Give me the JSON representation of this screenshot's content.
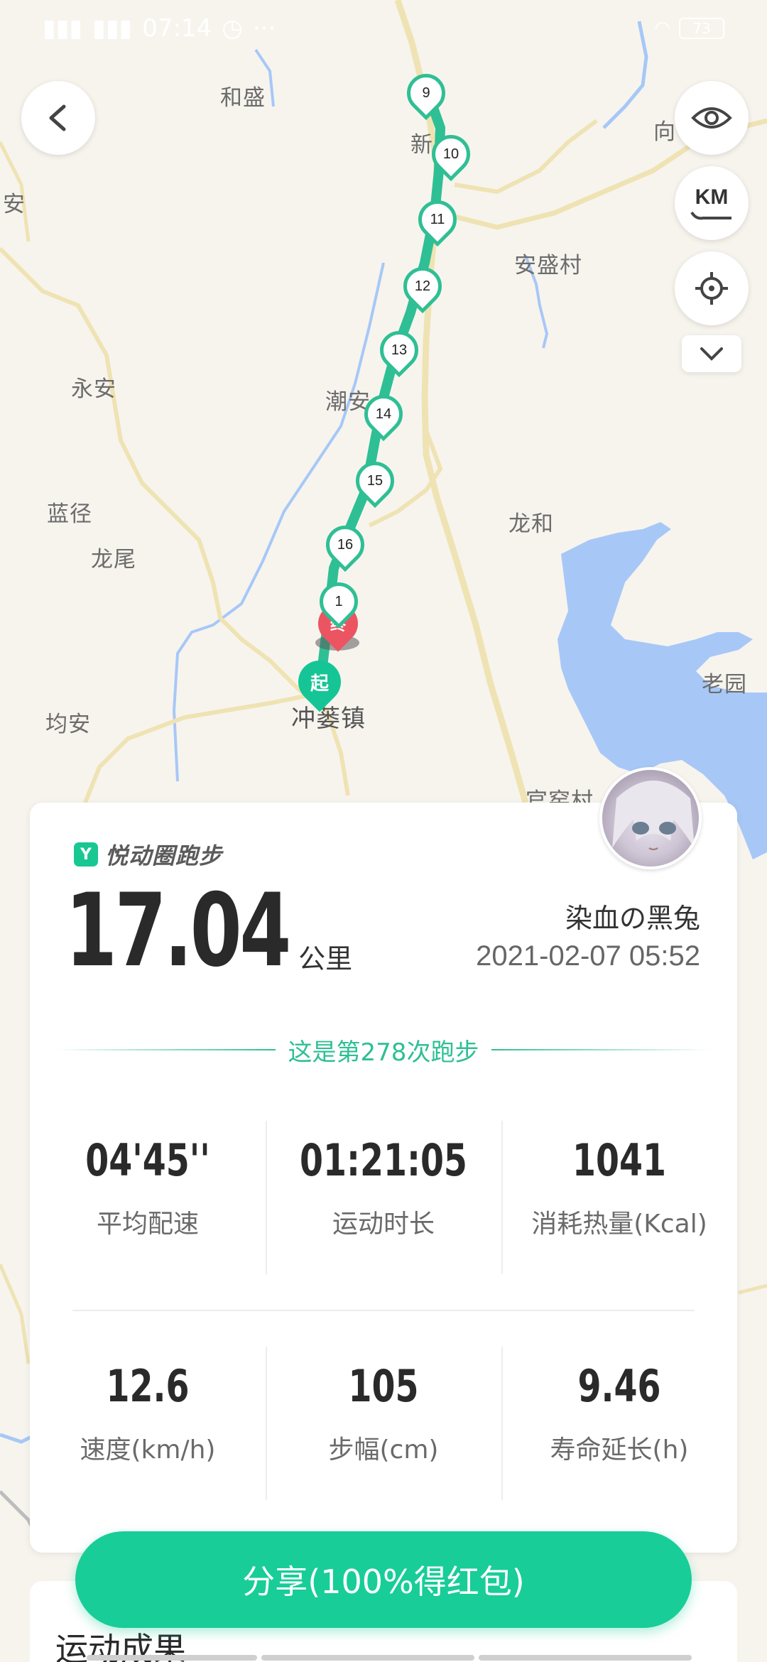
{
  "status_bar": {
    "time": "07:14",
    "battery": "73"
  },
  "map": {
    "places": [
      "和盛",
      "安",
      "永安",
      "蓝径",
      "龙尾",
      "均安",
      "冲蒌镇",
      "潮安",
      "龙和",
      "安盛村",
      "向",
      "老园",
      "官窑村",
      "新"
    ],
    "route_markers": [
      "9",
      "10",
      "11",
      "12",
      "13",
      "14",
      "15",
      "16",
      "1"
    ],
    "start_label": "起",
    "end_label": "终",
    "route_color": "#2fbf94",
    "water_color": "#a7c8f7"
  },
  "controls": {
    "km_label": "KM"
  },
  "card": {
    "brand": "悦动圈跑步",
    "distance": "17.04",
    "distance_unit": "公里",
    "user_name": "染血の黑兔",
    "date": "2021-02-07 05:52",
    "run_count_text": "这是第278次跑步",
    "stats_row1": [
      {
        "value": "04'45''",
        "label": "平均配速"
      },
      {
        "value": "01:21:05",
        "label": "运动时长"
      },
      {
        "value": "1041",
        "label": "消耗热量(Kcal)"
      }
    ],
    "stats_row2": [
      {
        "value": "12.6",
        "label": "速度(km/h)"
      },
      {
        "value": "105",
        "label": "步幅(cm)"
      },
      {
        "value": "9.46",
        "label": "寿命延长(h)"
      }
    ]
  },
  "share_label": "分享(100%得红包)",
  "results_title": "运动成果",
  "accent_color": "#18cd98"
}
